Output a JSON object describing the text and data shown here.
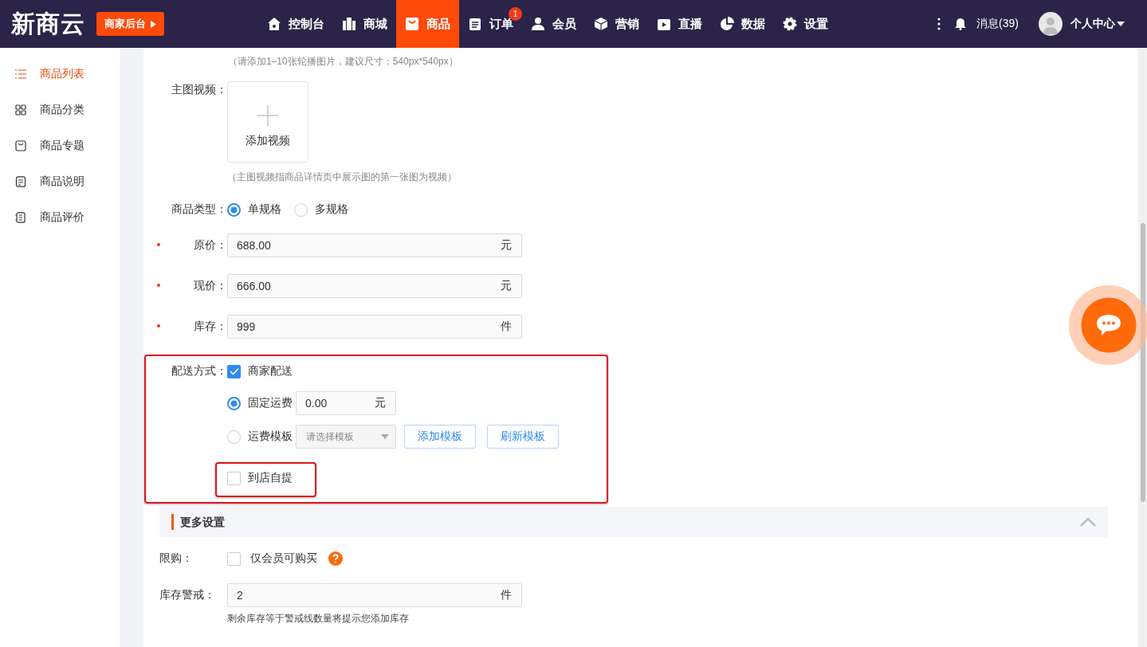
{
  "header": {
    "logo": "新商云",
    "backend_button": "商家后台",
    "nav": [
      {
        "label": "控制台",
        "kind": "home",
        "selected": false
      },
      {
        "label": "商城",
        "kind": "building",
        "selected": false
      },
      {
        "label": "商品",
        "kind": "bag",
        "selected": true
      },
      {
        "label": "订单",
        "kind": "clipboard",
        "selected": false,
        "badge": "1"
      },
      {
        "label": "会员",
        "kind": "user",
        "selected": false
      },
      {
        "label": "营销",
        "kind": "cube",
        "selected": false
      },
      {
        "label": "直播",
        "kind": "tv",
        "selected": false
      },
      {
        "label": "数据",
        "kind": "pie",
        "selected": false
      },
      {
        "label": "设置",
        "kind": "gear",
        "selected": false
      }
    ],
    "messages": "消息(39)",
    "user": "个人中心"
  },
  "sidebar": {
    "items": [
      {
        "label": "商品列表",
        "kind": "list",
        "selected": true
      },
      {
        "label": "商品分类",
        "kind": "grid",
        "selected": false
      },
      {
        "label": "商品专题",
        "kind": "bag",
        "selected": false
      },
      {
        "label": "商品说明",
        "kind": "doc",
        "selected": false
      },
      {
        "label": "商品评价",
        "kind": "note",
        "selected": false
      }
    ]
  },
  "form": {
    "carousel_hint": "（请添加1–10张轮播图片，建议尺寸：540px*540px）",
    "video": {
      "label": "主图视频：",
      "add_text": "添加视频",
      "hint": "（主图视频指商品详情页中展示图的第一张图为视频）"
    },
    "type": {
      "label": "商品类型：",
      "options": [
        {
          "label": "单规格",
          "selected": true
        },
        {
          "label": "多规格",
          "selected": false
        }
      ]
    },
    "price_fields": [
      {
        "label": "原价：",
        "required": true,
        "value": "688.00",
        "unit": "元"
      },
      {
        "label": "现价：",
        "required": true,
        "value": "666.00",
        "unit": "元"
      },
      {
        "label": "库存：",
        "required": true,
        "value": "999",
        "unit": "件"
      }
    ],
    "delivery": {
      "label": "配送方式：",
      "merchant": {
        "label": "商家配送",
        "checked": true
      },
      "fee_options": [
        {
          "kind": "fixed",
          "label": "固定运费",
          "selected": true,
          "value": "0.00",
          "unit": "元"
        },
        {
          "kind": "template",
          "label": "运费模板",
          "selected": false,
          "placeholder": "请选择模板",
          "buttons": [
            "添加模板",
            "刷新模板"
          ]
        }
      ],
      "pickup": {
        "label": "到店自提",
        "checked": false
      }
    },
    "more": {
      "title": "更多设置",
      "expanded": true,
      "limit": {
        "label": "限购：",
        "option": "仅会员可购买",
        "checked": false
      },
      "stock_alert": {
        "label": "库存警戒：",
        "value": "2",
        "unit": "件",
        "hint": "剩余库存等于警戒线数量将提示您添加库存"
      }
    }
  }
}
